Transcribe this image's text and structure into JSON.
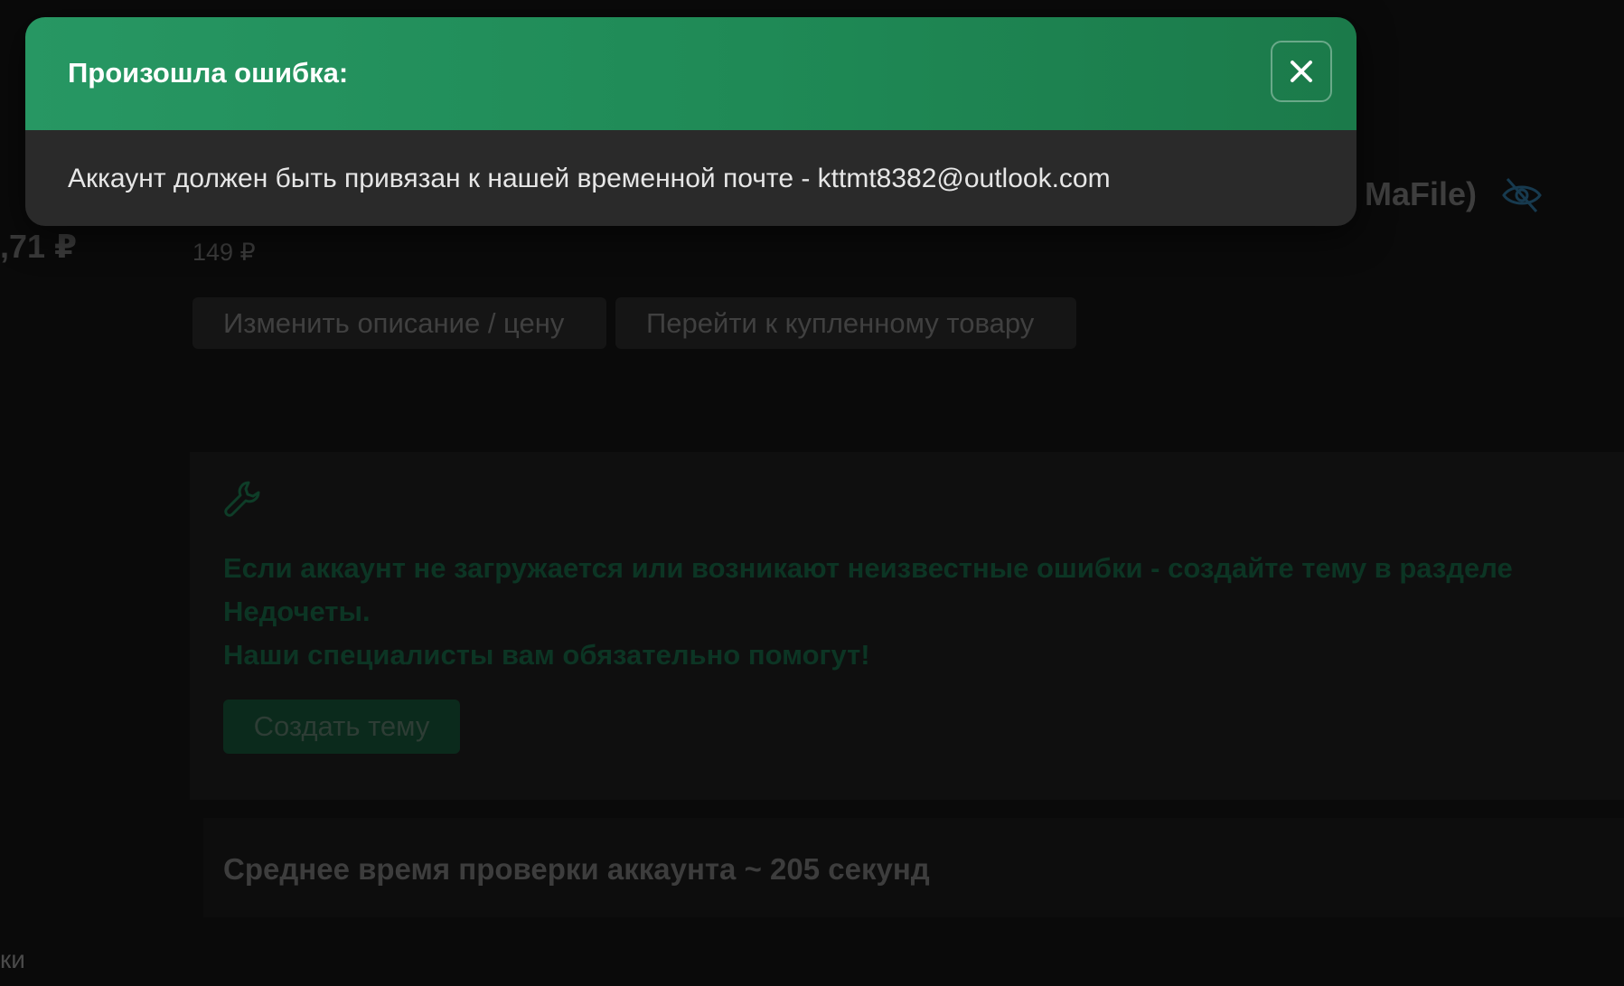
{
  "modal": {
    "title": "Произошла ошибка:",
    "message": "Аккаунт должен быть привязан к нашей временной почте - kttmt8382@outlook.com",
    "close_icon": "close-icon"
  },
  "background": {
    "left_price_fragment": ",71 ₽",
    "left_bottom_fragment": "ки",
    "title_fragment": "MaFile)",
    "visibility_icon": "eye-off-icon",
    "price": "149 ₽",
    "buttons": {
      "edit": "Изменить описание / цену",
      "goto": "Перейти к купленному товару"
    },
    "help_card": {
      "icon": "wrench-icon",
      "line1": "Если аккаунт не загружается или возникают неизвестные ошибки - создайте тему в разделе",
      "line2": "Недочеты.",
      "line3": "Наши специалисты вам обязательно помогут!",
      "create_button": "Создать тему"
    },
    "check_time": "Среднее время проверки аккаунта ~ 205 секунд"
  }
}
